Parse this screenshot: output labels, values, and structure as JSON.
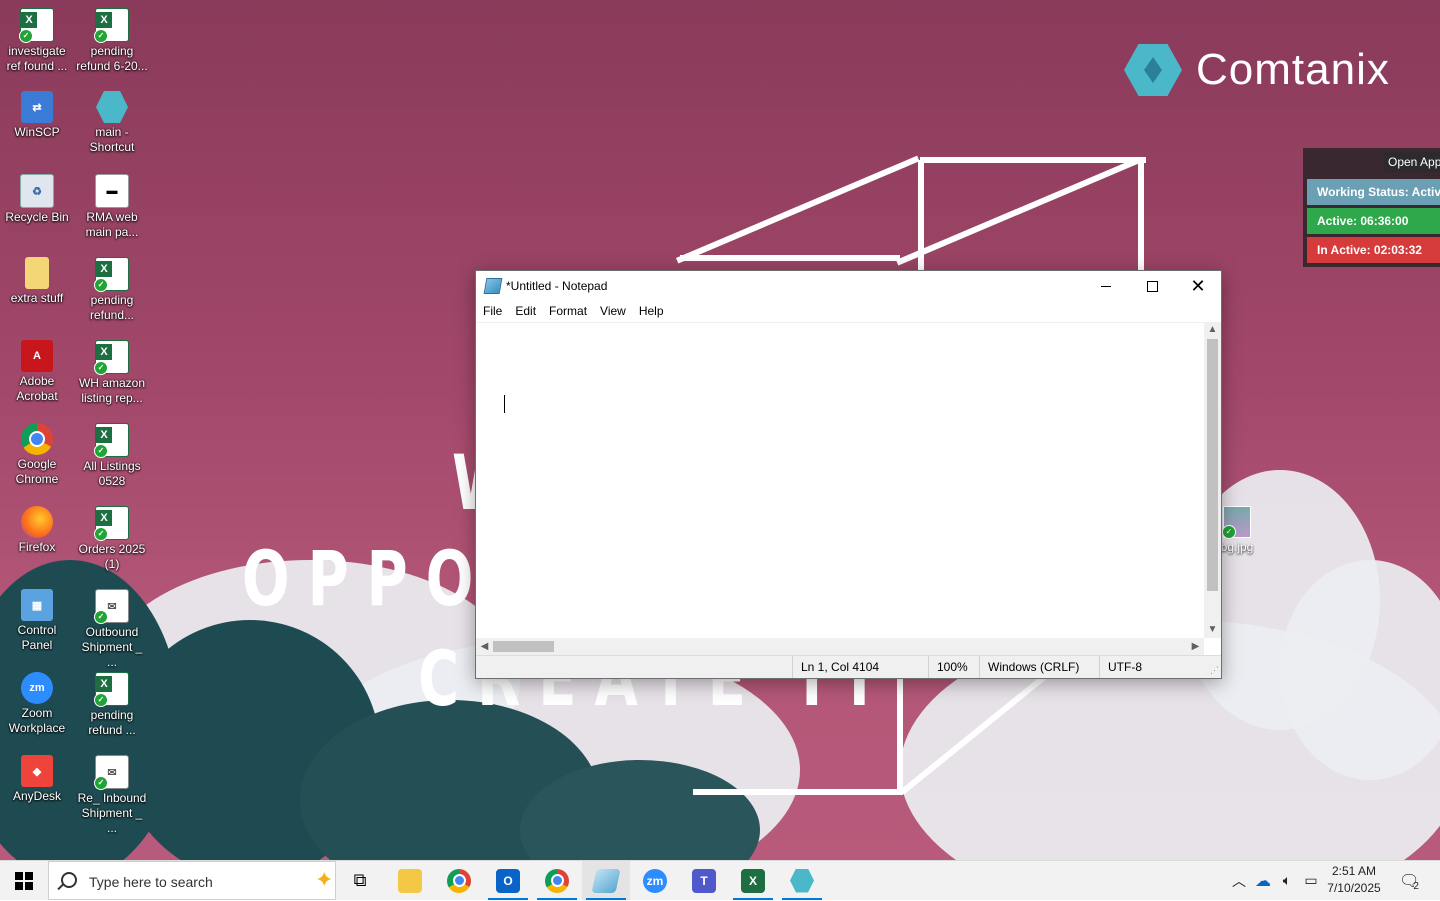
{
  "desktop": {
    "logo_text": "Comtanix",
    "icons": [
      {
        "label": "investigate ref found ...",
        "icon": "excel-icon"
      },
      {
        "label": "pending refund 6-20...",
        "icon": "excel-icon"
      },
      {
        "label": "WinSCP",
        "icon": "winscp-icon"
      },
      {
        "label": "main - Shortcut",
        "icon": "app-shortcut-icon"
      },
      {
        "label": "Recycle Bin",
        "icon": "recycle-bin-icon"
      },
      {
        "label": "RMA web main pa...",
        "icon": "document-icon"
      },
      {
        "label": "extra stuff",
        "icon": "folder-icon"
      },
      {
        "label": "pending refund...",
        "icon": "excel-icon"
      },
      {
        "label": "Adobe Acrobat",
        "icon": "adobe-acrobat-icon"
      },
      {
        "label": "WH amazon listing rep...",
        "icon": "excel-icon"
      },
      {
        "label": "Google Chrome",
        "icon": "chrome-icon"
      },
      {
        "label": "All Listings 0528",
        "icon": "excel-icon"
      },
      {
        "label": "Firefox",
        "icon": "firefox-icon"
      },
      {
        "label": "Orders 2025 (1)",
        "icon": "excel-icon"
      },
      {
        "label": "Control Panel",
        "icon": "control-panel-icon"
      },
      {
        "label": "Outbound Shipment _ ...",
        "icon": "mail-icon"
      },
      {
        "label": "Zoom Workplace",
        "icon": "zoom-icon"
      },
      {
        "label": "pending refund ...",
        "icon": "excel-icon"
      },
      {
        "label": "AnyDesk",
        "icon": "anydesk-icon"
      },
      {
        "label": "Re_ Inbound Shipment _ ...",
        "icon": "mail-icon"
      }
    ],
    "bg_file": {
      "label": "bg.jpg",
      "icon": "image-file-icon"
    },
    "wallpaper_text": {
      "line1": "W",
      "line2": "OPPO",
      "line3": "CREATE IT"
    }
  },
  "status_widget": {
    "open_label": "Open App",
    "working": "Working Status: Active",
    "active": "Active: 06:36:00",
    "inactive": "In Active: 02:03:32",
    "colors": {
      "working": "#6b9fb3",
      "active": "#2ea84a",
      "inactive": "#d63b3b"
    }
  },
  "notepad": {
    "title": "*Untitled - Notepad",
    "menu": [
      "File",
      "Edit",
      "Format",
      "View",
      "Help"
    ],
    "status": {
      "position": "Ln 1, Col 4104",
      "zoom": "100%",
      "line_ending": "Windows (CRLF)",
      "encoding": "UTF-8"
    }
  },
  "taskbar": {
    "search_placeholder": "Type here to search",
    "apps": [
      {
        "name": "task-view",
        "icon": "task-view-icon"
      },
      {
        "name": "file-explorer",
        "icon": "folder-icon"
      },
      {
        "name": "chrome",
        "icon": "chrome-icon"
      },
      {
        "name": "outlook",
        "icon": "outlook-icon"
      },
      {
        "name": "chrome-profile",
        "icon": "chrome-icon"
      },
      {
        "name": "notepad",
        "icon": "notepad-icon"
      },
      {
        "name": "zoom",
        "icon": "zoom-icon"
      },
      {
        "name": "teams",
        "icon": "teams-icon"
      },
      {
        "name": "excel",
        "icon": "excel-icon"
      },
      {
        "name": "comtanix",
        "icon": "comtanix-icon"
      }
    ],
    "time": "2:51 AM",
    "date": "7/10/2025",
    "notification_count": "2"
  }
}
